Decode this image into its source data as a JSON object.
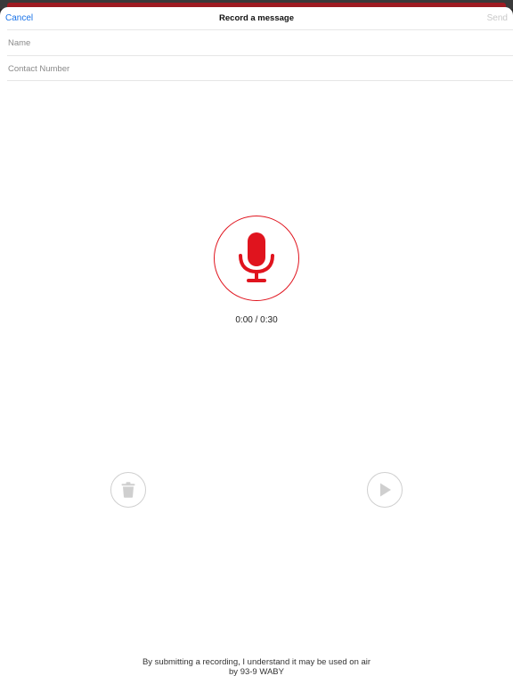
{
  "navbar": {
    "cancel_label": "Cancel",
    "title": "Record a message",
    "send_label": "Send"
  },
  "form": {
    "name_placeholder": "Name",
    "name_value": "",
    "contact_placeholder": "Contact Number",
    "contact_value": ""
  },
  "recorder": {
    "elapsed": "0:00",
    "separator": " / ",
    "max_duration": "0:30",
    "record_icon": "microphone-icon",
    "delete_icon": "trash-icon",
    "play_icon": "play-icon"
  },
  "footer": {
    "line1": "By submitting a recording, I understand it may be used on air",
    "line2": "by 93-9 WABY"
  },
  "colors": {
    "accent_red": "#e0141e",
    "link_blue": "#1a73e8",
    "disabled_gray": "#c8c8c8",
    "brand_strip": "#9e1b22"
  }
}
